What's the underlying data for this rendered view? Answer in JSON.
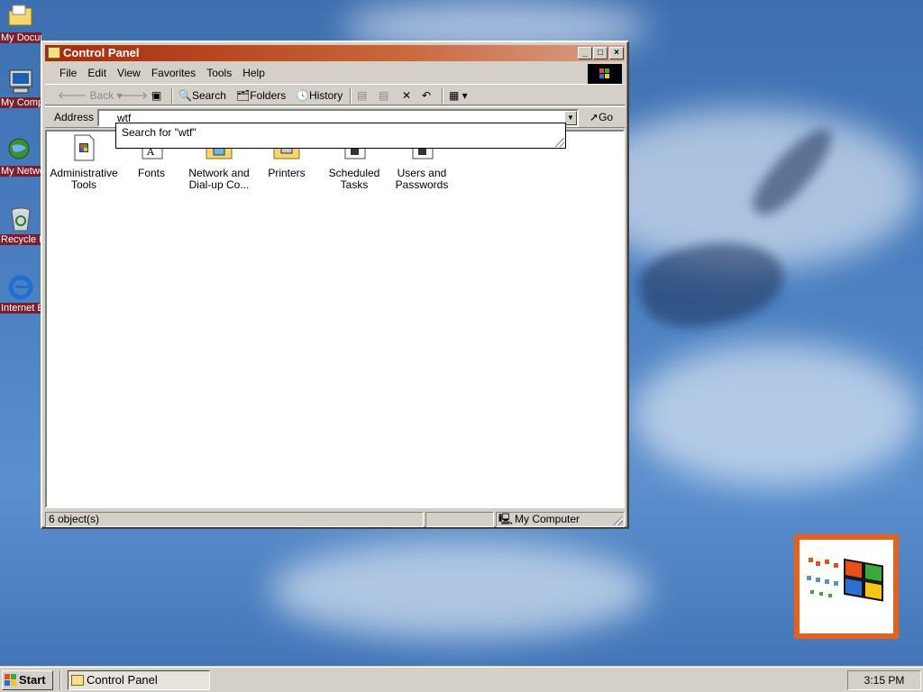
{
  "desktop": {
    "icons": [
      {
        "label": "My Documents"
      },
      {
        "label": "My Computer"
      },
      {
        "label": "My Network Places"
      },
      {
        "label": "Recycle Bin"
      },
      {
        "label": "Internet Explorer"
      }
    ]
  },
  "window": {
    "title": "Control Panel",
    "menu": [
      "File",
      "Edit",
      "View",
      "Favorites",
      "Tools",
      "Help"
    ],
    "toolbar": {
      "back": "Back",
      "search": "Search",
      "folders": "Folders",
      "history": "History"
    },
    "address": {
      "label": "Address",
      "value": "wtf",
      "go": "Go"
    },
    "autocomplete": "Search for \"wtf\"",
    "items": [
      {
        "label": "Administrative Tools"
      },
      {
        "label": "Fonts"
      },
      {
        "label": "Network and Dial-up Co..."
      },
      {
        "label": "Printers"
      },
      {
        "label": "Scheduled Tasks"
      },
      {
        "label": "Users and Passwords"
      }
    ],
    "status": {
      "count": "6 object(s)",
      "zone": "My Computer"
    }
  },
  "taskbar": {
    "start": "Start",
    "task": "Control Panel",
    "clock": "3:15 PM"
  },
  "colors": {
    "titlebar_start": "#a62a0b",
    "desktop": "#3d6fb0",
    "chrome": "#d4d0c8"
  }
}
